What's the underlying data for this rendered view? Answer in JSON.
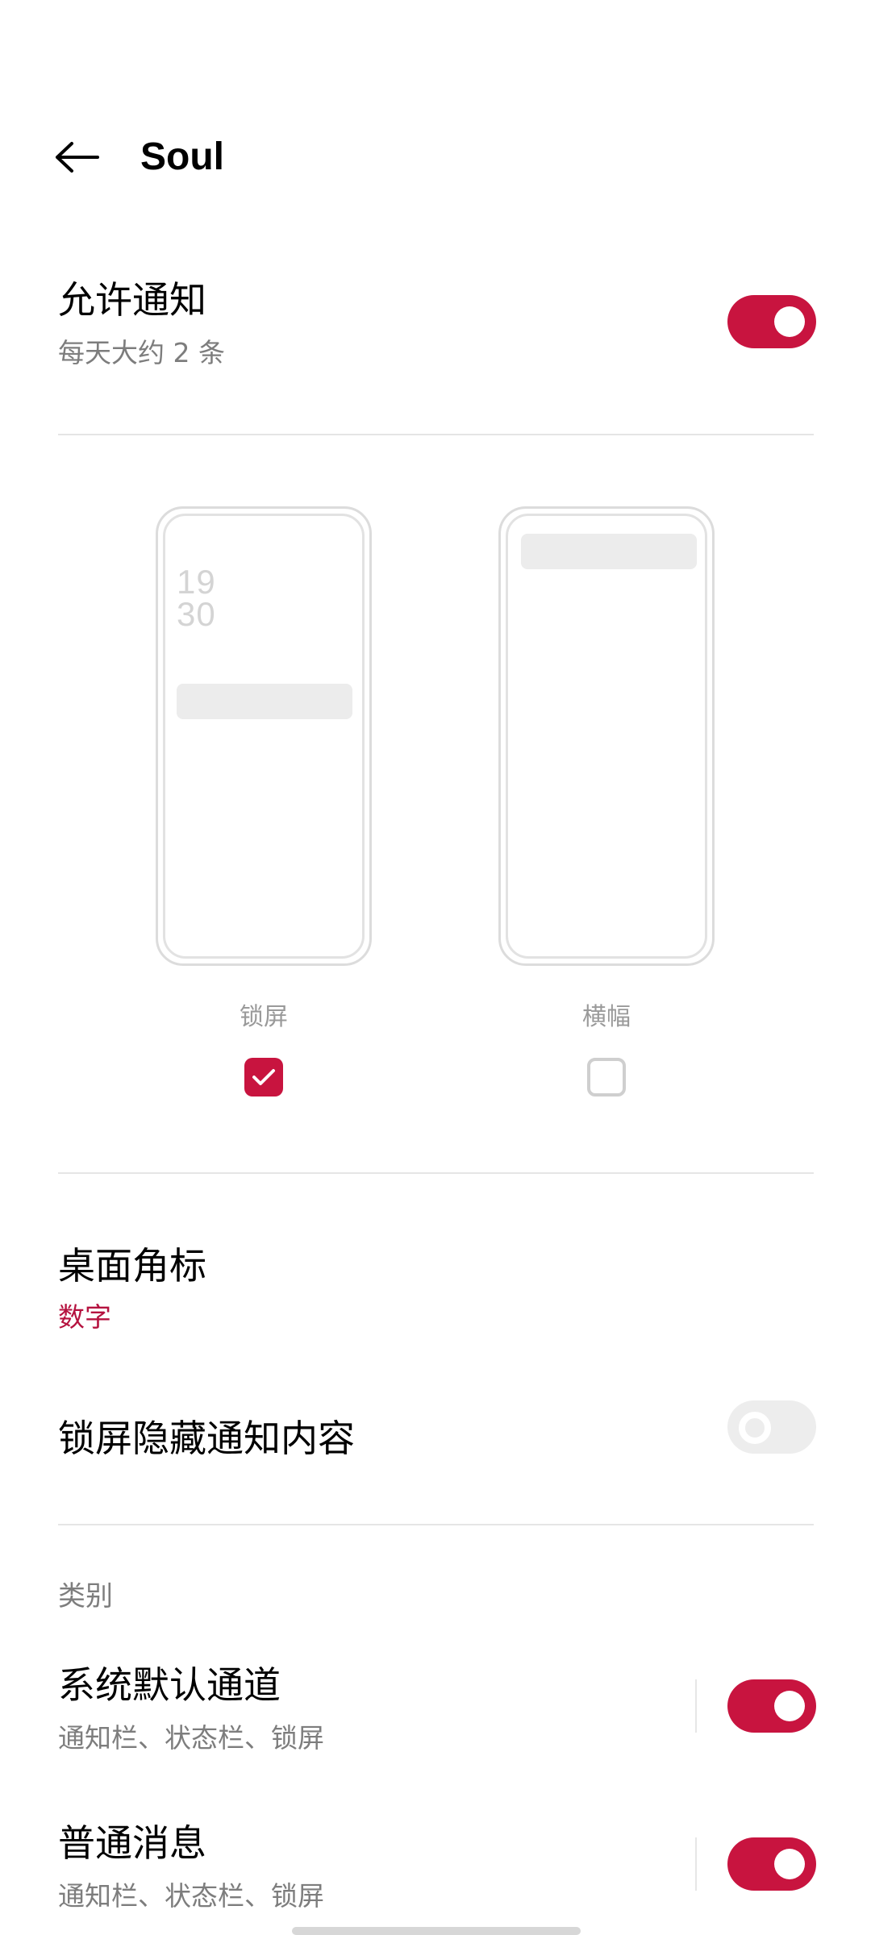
{
  "header": {
    "title": "Soul"
  },
  "allow_notifications": {
    "title": "允许通知",
    "subtitle": "每天大约 2 条",
    "enabled": true
  },
  "styles": {
    "lock_screen": {
      "label": "锁屏",
      "time_hour": "19",
      "time_min": "30",
      "checked": true
    },
    "banner": {
      "label": "横幅",
      "checked": false
    }
  },
  "badge": {
    "title": "桌面角标",
    "value": "数字"
  },
  "hide_lock_content": {
    "title": "锁屏隐藏通知内容",
    "enabled": false
  },
  "categories": {
    "label": "类别",
    "items": [
      {
        "title": "系统默认通道",
        "subtitle": "通知栏、状态栏、锁屏",
        "enabled": true
      },
      {
        "title": "普通消息",
        "subtitle": "通知栏、状态栏、锁屏",
        "enabled": true
      }
    ]
  },
  "colors": {
    "accent": "#c8143f",
    "accent_text": "#b5123f"
  }
}
